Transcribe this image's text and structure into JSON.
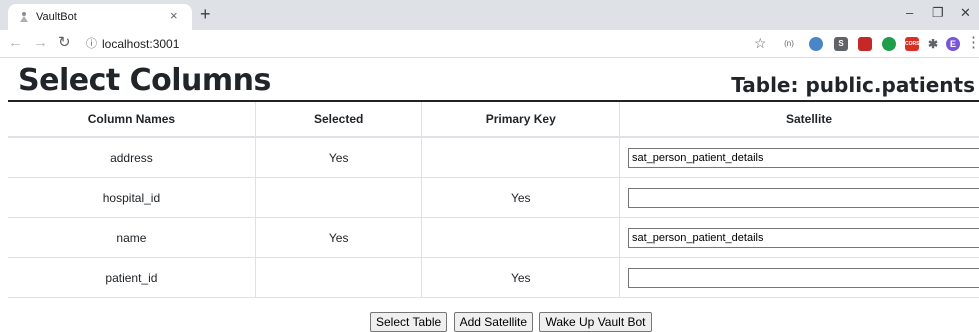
{
  "browser": {
    "tab_title": "VaultBot",
    "tab_close": "×",
    "new_tab": "+",
    "url": "localhost:3001",
    "extensions": [
      {
        "icon": "ext-label-icon",
        "label": "(n)",
        "color": "#5f6368"
      },
      {
        "icon": "ext-blue-circle-icon",
        "label": "",
        "color": "#4a86c5"
      },
      {
        "icon": "ext-s-icon",
        "label": "S",
        "color": "#5f6368"
      },
      {
        "icon": "ext-red-icon",
        "label": "",
        "color": "#c62828"
      },
      {
        "icon": "ext-green-icon",
        "label": "",
        "color": "#1e9e4a"
      },
      {
        "icon": "ext-cors-icon",
        "label": "CORS",
        "color": "#d93025"
      },
      {
        "icon": "puzzle-icon",
        "label": "",
        "color": "#5f6368"
      },
      {
        "icon": "profile-avatar-icon",
        "label": "E",
        "color": "#7b55d8"
      }
    ]
  },
  "page": {
    "title": "Select Columns",
    "table_label": "Table: public.patients"
  },
  "table": {
    "headers": [
      "Column Names",
      "Selected",
      "Primary Key",
      "Satellite"
    ],
    "rows": [
      {
        "column": "address",
        "selected": "Yes",
        "primary_key": "",
        "satellite": "sat_person_patient_details"
      },
      {
        "column": "hospital_id",
        "selected": "",
        "primary_key": "Yes",
        "satellite": ""
      },
      {
        "column": "name",
        "selected": "Yes",
        "primary_key": "",
        "satellite": "sat_person_patient_details"
      },
      {
        "column": "patient_id",
        "selected": "",
        "primary_key": "Yes",
        "satellite": ""
      }
    ]
  },
  "buttons": {
    "select_table": "Select Table",
    "add_satellite": "Add Satellite",
    "wake_up": "Wake Up Vault Bot"
  }
}
